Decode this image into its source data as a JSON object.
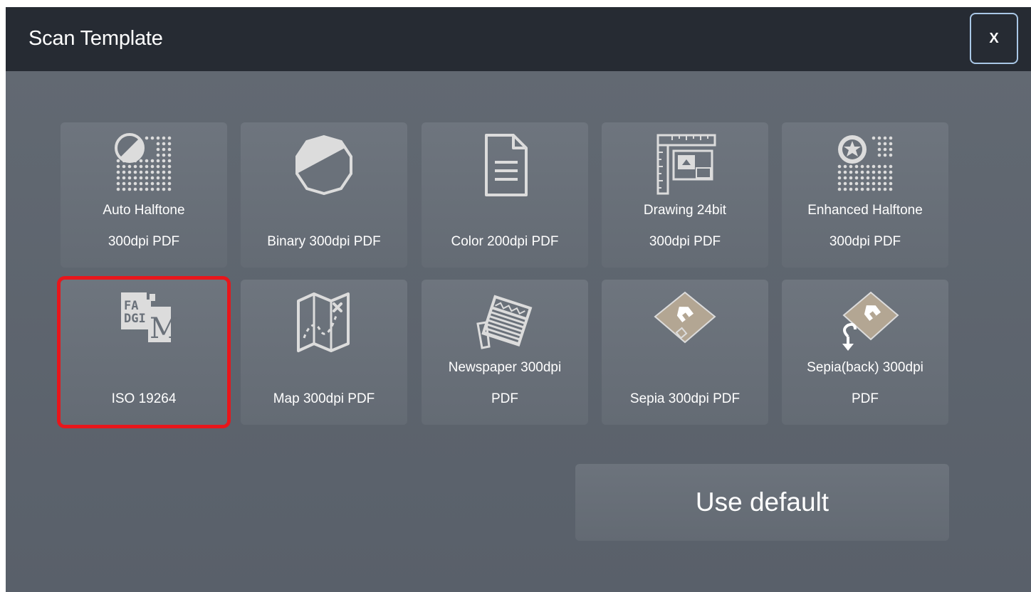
{
  "dialog": {
    "title": "Scan Template",
    "close_label": "X"
  },
  "templates": [
    {
      "line1": "Auto Halftone",
      "line2": "300dpi PDF",
      "icon": "halftone-icon"
    },
    {
      "line1": "",
      "line2": "Binary 300dpi PDF",
      "icon": "binary-icon"
    },
    {
      "line1": "",
      "line2": "Color 200dpi PDF",
      "icon": "document-icon"
    },
    {
      "line1": "Drawing 24bit",
      "line2": "300dpi PDF",
      "icon": "drawing-icon"
    },
    {
      "line1": "Enhanced Halftone",
      "line2": "300dpi PDF",
      "icon": "enhanced-halftone-icon"
    },
    {
      "line1": "",
      "line2": "ISO 19264",
      "icon": "fadgi-iso-icon",
      "selected": true
    },
    {
      "line1": "",
      "line2": "Map 300dpi PDF",
      "icon": "map-icon"
    },
    {
      "line1": "Newspaper 300dpi",
      "line2": "PDF",
      "icon": "newspaper-icon"
    },
    {
      "line1": "",
      "line2": "Sepia 300dpi PDF",
      "icon": "sepia-icon"
    },
    {
      "line1": "Sepia(back) 300dpi",
      "line2": "PDF",
      "icon": "sepia-back-icon"
    }
  ],
  "use_default_label": "Use default",
  "colors": {
    "titlebar": "#262b33",
    "background": "#5d646d",
    "tile": "#6a717a",
    "icon": "#dcdcdc",
    "sepia": "#b3a693",
    "selected_outline": "#e8161b",
    "close_border": "#a9c7e6"
  }
}
